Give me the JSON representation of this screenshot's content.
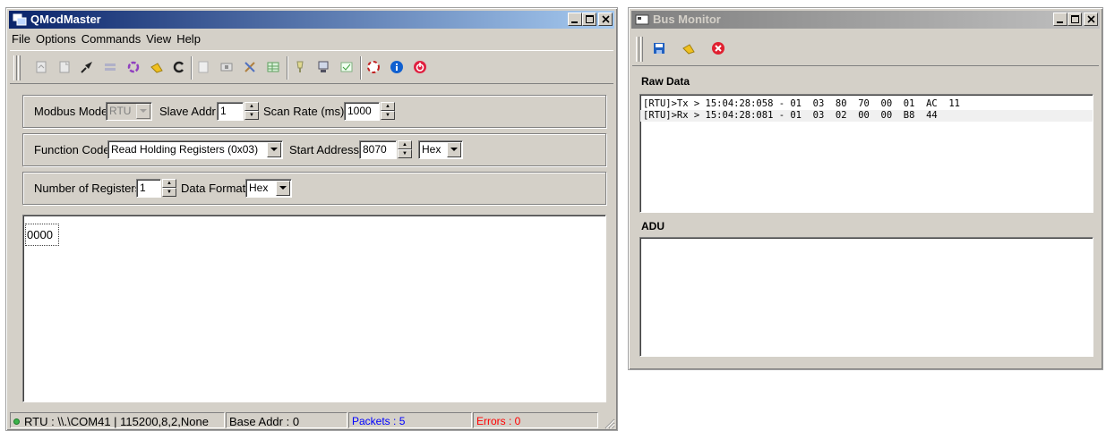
{
  "main_window": {
    "title": "QModMaster",
    "menu": [
      "File",
      "Options",
      "Commands",
      "View",
      "Help"
    ],
    "toolbar_icons": [
      "load-session-icon",
      "save-session-icon",
      "connect-icon",
      "serial-rtu-icon",
      "tcp-icon",
      "clear-icon",
      "reset-icon",
      "read-write-icon",
      "scan-icon",
      "tools-icon",
      "bus-monitor-icon",
      "log-icon",
      "settings-icon",
      "headers-icon",
      "about-qt-icon",
      "info-icon",
      "exit-icon"
    ],
    "modbus_mode_label": "Modbus Mode",
    "modbus_mode_value": "RTU",
    "slave_addr_label": "Slave Addr",
    "slave_addr_value": "1",
    "scan_rate_label": "Scan Rate (ms)",
    "scan_rate_value": "1000",
    "function_code_label": "Function Code",
    "function_code_value": "Read Holding Registers (0x03)",
    "start_address_label": "Start Address",
    "start_address_value": "8070",
    "start_address_format": "Hex",
    "num_registers_label": "Number of Registers",
    "num_registers_value": "1",
    "data_format_label": "Data Format",
    "data_format_value": "Hex",
    "register_values": [
      "0000"
    ],
    "status": {
      "connection": "RTU : \\\\.\\COM41 | 115200,8,2,None",
      "base_addr": "Base Addr : 0",
      "packets": "Packets : 5",
      "errors": "Errors : 0",
      "packets_color": "#0000ff",
      "errors_color": "#ff0000"
    }
  },
  "bus_monitor": {
    "title": "Bus Monitor",
    "toolbar_icons": [
      "save-icon",
      "clear-icon",
      "exit-icon"
    ],
    "raw_data_label": "Raw Data",
    "raw_data": [
      "[RTU]>Tx > 15:04:28:058 - 01  03  80  70  00  01  AC  11",
      "[RTU]>Rx > 15:04:28:081 - 01  03  02  00  00  B8  44"
    ],
    "adu_label": "ADU"
  }
}
